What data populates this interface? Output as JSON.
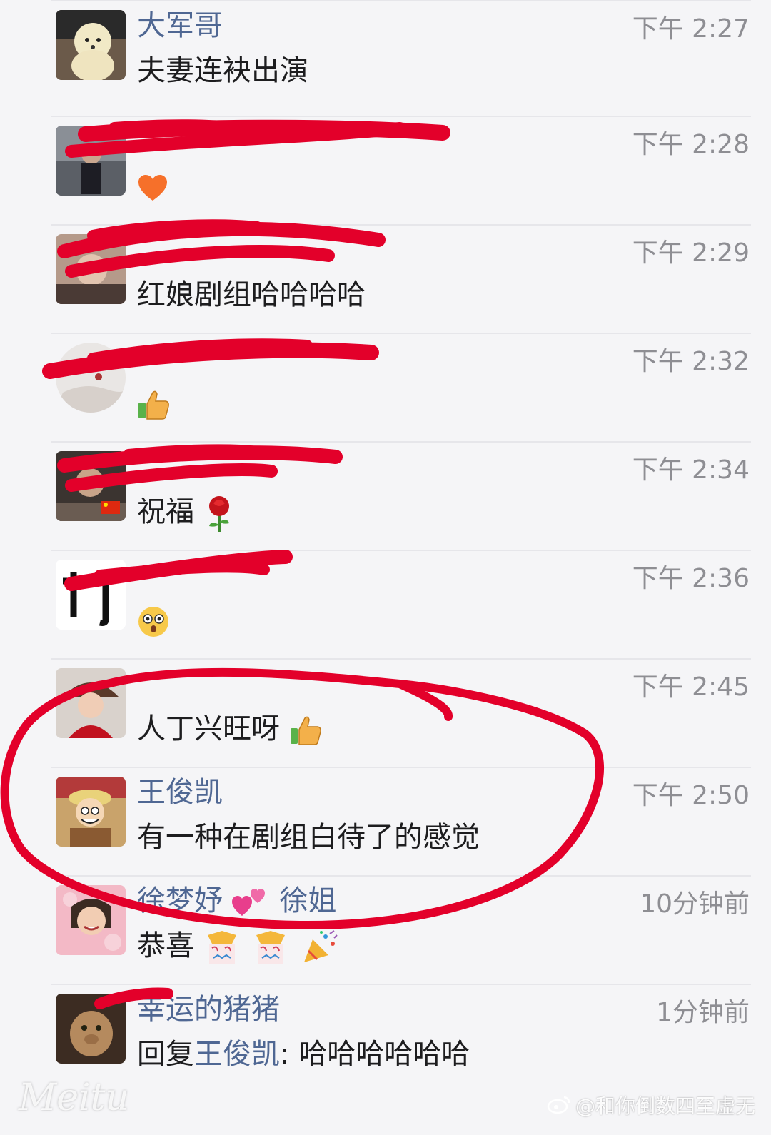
{
  "comments": [
    {
      "name": "大军哥",
      "time": "下午 2:27",
      "text": "夫妻连袂出演",
      "emoji": [],
      "redacted": false
    },
    {
      "name": "",
      "time": "下午 2:28",
      "text": "",
      "emoji": [
        "heart-emoji"
      ],
      "redacted": true
    },
    {
      "name": "",
      "time": "下午 2:29",
      "text": "红娘剧组哈哈哈哈",
      "emoji": [],
      "redacted": true
    },
    {
      "name": "",
      "time": "下午 2:32",
      "text": "",
      "emoji": [
        "thumbs-up-emoji"
      ],
      "redacted": true
    },
    {
      "name": "",
      "time": "下午 2:34",
      "text": "祝福",
      "emoji": [
        "rose-emoji"
      ],
      "redacted": true
    },
    {
      "name": "",
      "time": "下午 2:36",
      "text": "",
      "emoji": [
        "astonished-face-emoji"
      ],
      "redacted": true
    },
    {
      "name": "",
      "time": "下午 2:45",
      "text": "人丁兴旺呀",
      "emoji": [
        "thumbs-up-emoji"
      ],
      "redacted": true
    },
    {
      "name": "王俊凯",
      "time": "下午 2:50",
      "text": "有一种在剧组白待了的感觉",
      "emoji": [],
      "redacted": false
    },
    {
      "name": "徐梦妤",
      "name_suffix": "徐姐",
      "time": "10分钟前",
      "text": "恭喜",
      "emoji": [
        "two-hearts-emoji",
        "celebration-emoji",
        "celebration-emoji",
        "party-popper-emoji"
      ],
      "redacted": false
    },
    {
      "name": "幸运的猪猪",
      "time": "1分钟前",
      "text_prefix": "回复",
      "mention": "王俊凯",
      "text": ": 哈哈哈哈哈哈",
      "emoji": [],
      "redacted": true
    }
  ],
  "watermark": {
    "left": "Meitu",
    "right": "@和你倒数四至虚无"
  },
  "colors": {
    "name": "#4f6793",
    "message": "#1d1d1f",
    "time": "#8e8e93",
    "background": "#f5f5f7",
    "scribble": "#e3002a"
  }
}
